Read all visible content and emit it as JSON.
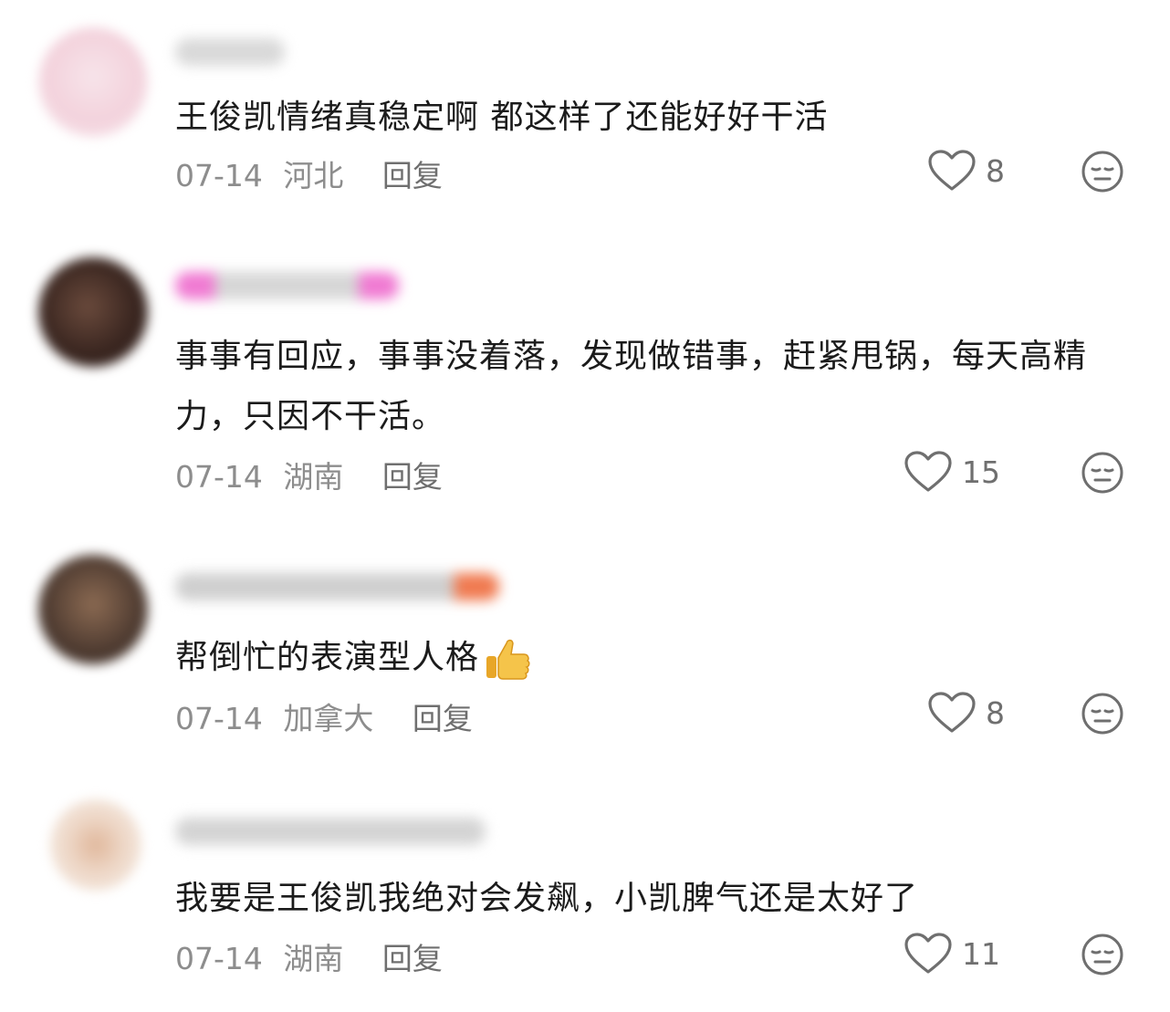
{
  "comments": [
    {
      "text": "王俊凯情绪真稳定啊 都这样了还能好好干活",
      "date": "07-14",
      "location": "河北",
      "reply_label": "回复",
      "likes": "8"
    },
    {
      "text": "事事有回应，事事没着落，发现做错事，赶紧甩锅，每天高精力，只因不干活。",
      "date": "07-14",
      "location": "湖南",
      "reply_label": "回复",
      "likes": "15"
    },
    {
      "text": "帮倒忙的表演型人格",
      "emoji": "thumbs-up-icon",
      "date": "07-14",
      "location": "加拿大",
      "reply_label": "回复",
      "likes": "8"
    },
    {
      "text": "我要是王俊凯我绝对会发飙，小凯脾气还是太好了",
      "date": "07-14",
      "location": "湖南",
      "reply_label": "回复",
      "likes": "11"
    }
  ],
  "icons": {
    "like": "heart-outline-icon",
    "reaction": "neutral-face-icon"
  },
  "colors": {
    "text": "#1b1b1b",
    "meta": "#8d8d8d",
    "icon": "#6f6f6f"
  }
}
